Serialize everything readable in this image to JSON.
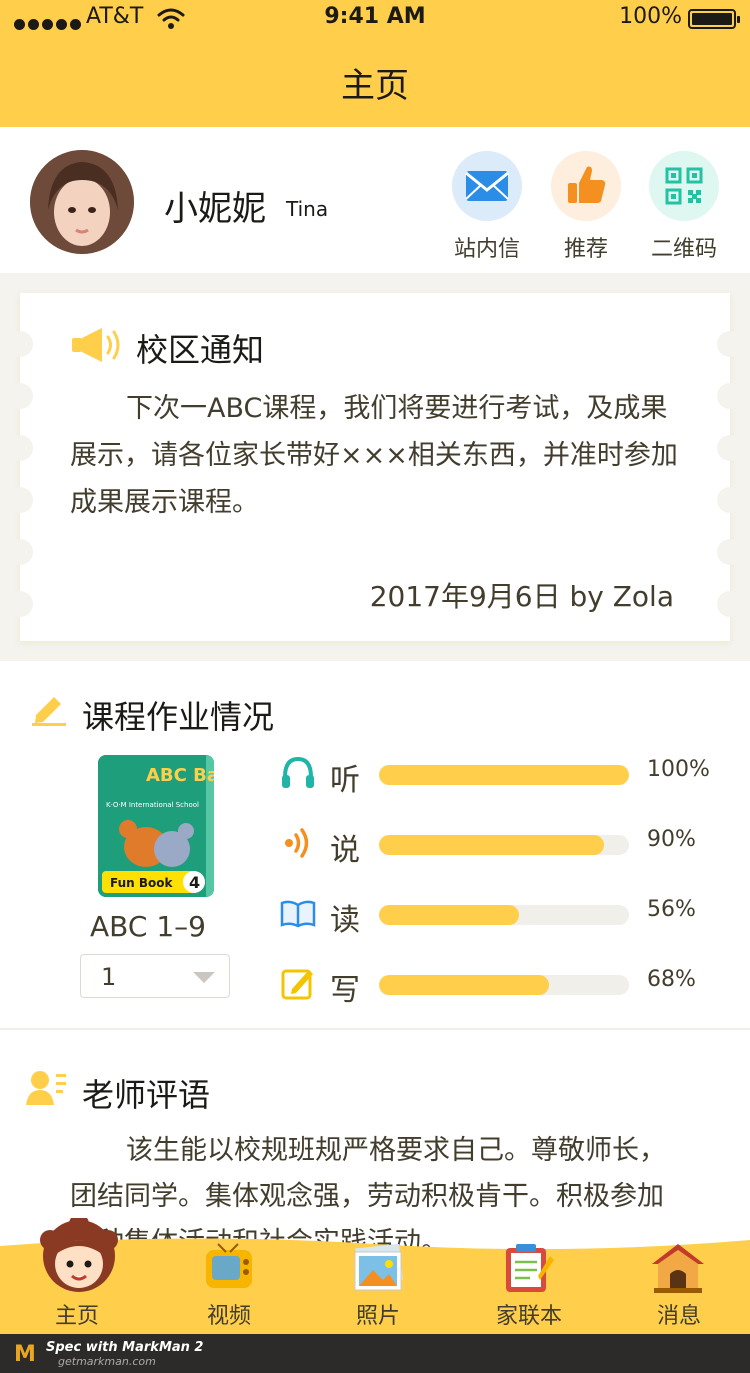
{
  "status": {
    "carrier": "AT&T",
    "time": "9:41 AM",
    "battery": "100%"
  },
  "header": {
    "title": "主页"
  },
  "profile": {
    "name": "小妮妮",
    "name_en": "Tina",
    "actions": [
      {
        "label": "站内信",
        "icon": "mail-icon"
      },
      {
        "label": "推荐",
        "icon": "thumbs-up-icon"
      },
      {
        "label": "二维码",
        "icon": "qr-code-icon"
      }
    ]
  },
  "notice": {
    "title": "校区通知",
    "body": "下次一ABC课程，我们将要进行考试，及成果展示，请各位家长带好×××相关东西，并准时参加成果展示课程。",
    "date": "2017年9月6日 by Zola"
  },
  "homework": {
    "title": "课程作业情况",
    "book_cover": {
      "title": "ABC Bakery",
      "school": "K·O·M International School",
      "badge": "Fun Book",
      "number": "4"
    },
    "book_name": "ABC 1–9",
    "select_value": "1",
    "skills": [
      {
        "label": "听",
        "percent": 100,
        "percent_text": "100%",
        "icon": "headphones-icon"
      },
      {
        "label": "说",
        "percent": 90,
        "percent_text": "90%",
        "icon": "speaking-icon"
      },
      {
        "label": "读",
        "percent": 56,
        "percent_text": "56%",
        "icon": "open-book-icon"
      },
      {
        "label": "写",
        "percent": 68,
        "percent_text": "68%",
        "icon": "writing-icon"
      }
    ]
  },
  "comment": {
    "title": "老师评语",
    "body": "该生能以校规班规严格要求自己。尊敬师长，团结同学。集体观念强，劳动积极肯干。积极参加各种集体活动和社会实践活动。"
  },
  "tabbar": {
    "tabs": [
      {
        "label": "主页",
        "icon": "home-avatar-icon"
      },
      {
        "label": "视频",
        "icon": "tv-icon"
      },
      {
        "label": "照片",
        "icon": "photo-icon"
      },
      {
        "label": "家联本",
        "icon": "notebook-icon"
      },
      {
        "label": "消息",
        "icon": "doghouse-icon"
      }
    ]
  },
  "footer": {
    "brand_line": "Spec with MarkMan 2",
    "url": "getmarkman.com"
  },
  "colors": {
    "brand_yellow": "#ffce4b",
    "text_dark": "#1b1a16",
    "text_body": "#433d2e",
    "page_bg": "#f4f3ee",
    "shadow": "#d3bf14"
  }
}
